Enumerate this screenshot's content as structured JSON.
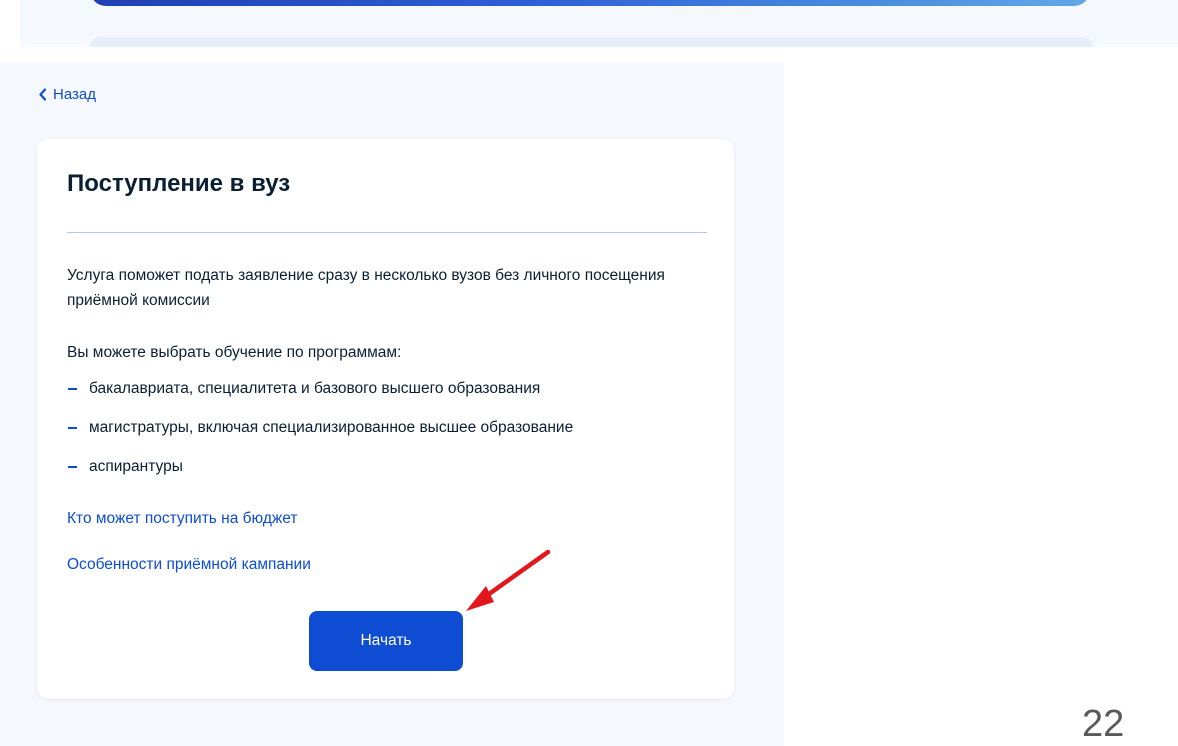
{
  "nav": {
    "back_label": "Назад"
  },
  "card": {
    "title": "Поступление в вуз",
    "description": "Услуга поможет подать заявление сразу в несколько вузов без личного посещения приёмной комиссии",
    "programs_intro": "Вы можете выбрать обучение по программам:",
    "programs": [
      "бакалавриата, специалитета и базового высшего образования",
      "магистратуры, включая специализированное высшее образование",
      "аспирантуры"
    ],
    "links": {
      "budget": "Кто может поступить на бюджет",
      "campaign": "Особенности приёмной кампании"
    },
    "start_button_label": "Начать"
  },
  "slide_number": "22",
  "icons": {
    "back": "chevron-left-icon",
    "pointer": "red-arrow-annotation"
  },
  "colors": {
    "accent": "#0d4cd3",
    "page_bg": "#f5f8fc",
    "text": "#0b1f33",
    "annotation": "#e3161b"
  }
}
